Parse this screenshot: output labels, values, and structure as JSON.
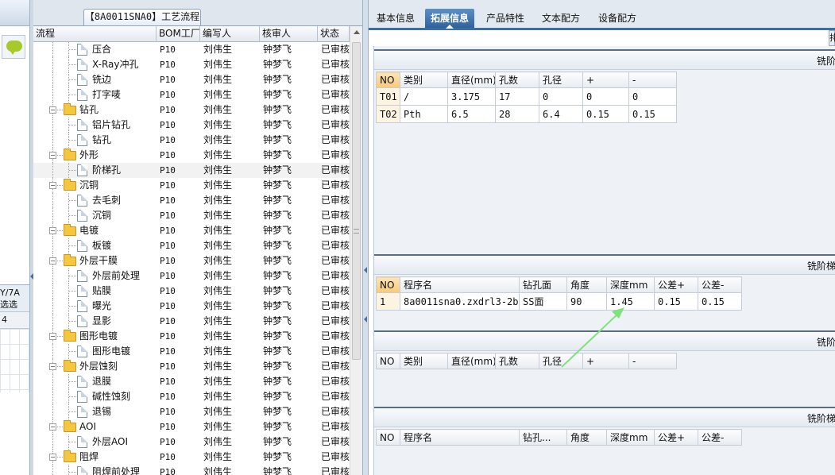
{
  "left_panel": {
    "filter_line1": "Y/7A",
    "filter_line2": "选选",
    "filter_num": "4"
  },
  "tree": {
    "tab_title": "【8A0011SNA0】工艺流程",
    "columns": [
      "流程",
      "BOM工厂",
      "编写人",
      "核审人",
      "状态"
    ],
    "rows": [
      {
        "level": 2,
        "type": "file",
        "name": "压合",
        "bom": "P10",
        "writer": "刘伟生",
        "reviewer": "钟梦飞",
        "status": "已审核"
      },
      {
        "level": 2,
        "type": "file",
        "name": "X-Ray冲孔",
        "bom": "P10",
        "writer": "刘伟生",
        "reviewer": "钟梦飞",
        "status": "已审核"
      },
      {
        "level": 2,
        "type": "file",
        "name": "铣边",
        "bom": "P10",
        "writer": "刘伟生",
        "reviewer": "钟梦飞",
        "status": "已审核"
      },
      {
        "level": 2,
        "type": "file",
        "name": "打字唛",
        "bom": "P10",
        "writer": "刘伟生",
        "reviewer": "钟梦飞",
        "status": "已审核"
      },
      {
        "level": 1,
        "type": "folder",
        "name": "钻孔",
        "bom": "P10",
        "writer": "刘伟生",
        "reviewer": "钟梦飞",
        "status": "已审核"
      },
      {
        "level": 2,
        "type": "file",
        "name": "铝片钻孔",
        "bom": "P10",
        "writer": "刘伟生",
        "reviewer": "钟梦飞",
        "status": "已审核"
      },
      {
        "level": 2,
        "type": "file",
        "name": "钻孔",
        "bom": "P10",
        "writer": "刘伟生",
        "reviewer": "钟梦飞",
        "status": "已审核"
      },
      {
        "level": 1,
        "type": "folder",
        "name": "外形",
        "bom": "P10",
        "writer": "刘伟生",
        "reviewer": "钟梦飞",
        "status": "已审核"
      },
      {
        "level": 2,
        "type": "file",
        "name": "阶梯孔",
        "bom": "P10",
        "writer": "刘伟生",
        "reviewer": "钟梦飞",
        "status": "已审核",
        "selected": true
      },
      {
        "level": 1,
        "type": "folder",
        "name": "沉铜",
        "bom": "P10",
        "writer": "刘伟生",
        "reviewer": "钟梦飞",
        "status": "已审核"
      },
      {
        "level": 2,
        "type": "file",
        "name": "去毛刺",
        "bom": "P10",
        "writer": "刘伟生",
        "reviewer": "钟梦飞",
        "status": "已审核"
      },
      {
        "level": 2,
        "type": "file",
        "name": "沉铜",
        "bom": "P10",
        "writer": "刘伟生",
        "reviewer": "钟梦飞",
        "status": "已审核"
      },
      {
        "level": 1,
        "type": "folder",
        "name": "电镀",
        "bom": "P10",
        "writer": "刘伟生",
        "reviewer": "钟梦飞",
        "status": "已审核"
      },
      {
        "level": 2,
        "type": "file",
        "name": "板镀",
        "bom": "P10",
        "writer": "刘伟生",
        "reviewer": "钟梦飞",
        "status": "已审核"
      },
      {
        "level": 1,
        "type": "folder",
        "name": "外层干膜",
        "bom": "P10",
        "writer": "刘伟生",
        "reviewer": "钟梦飞",
        "status": "已审核"
      },
      {
        "level": 2,
        "type": "file",
        "name": "外层前处理",
        "bom": "P10",
        "writer": "刘伟生",
        "reviewer": "钟梦飞",
        "status": "已审核"
      },
      {
        "level": 2,
        "type": "file",
        "name": "贴膜",
        "bom": "P10",
        "writer": "刘伟生",
        "reviewer": "钟梦飞",
        "status": "已审核"
      },
      {
        "level": 2,
        "type": "file",
        "name": "曝光",
        "bom": "P10",
        "writer": "刘伟生",
        "reviewer": "钟梦飞",
        "status": "已审核"
      },
      {
        "level": 2,
        "type": "file",
        "name": "显影",
        "bom": "P10",
        "writer": "刘伟生",
        "reviewer": "钟梦飞",
        "status": "已审核"
      },
      {
        "level": 1,
        "type": "folder",
        "name": "图形电镀",
        "bom": "P10",
        "writer": "刘伟生",
        "reviewer": "钟梦飞",
        "status": "已审核"
      },
      {
        "level": 2,
        "type": "file",
        "name": "图形电镀",
        "bom": "P10",
        "writer": "刘伟生",
        "reviewer": "钟梦飞",
        "status": "已审核"
      },
      {
        "level": 1,
        "type": "folder",
        "name": "外层蚀刻",
        "bom": "P10",
        "writer": "刘伟生",
        "reviewer": "钟梦飞",
        "status": "已审核"
      },
      {
        "level": 2,
        "type": "file",
        "name": "退膜",
        "bom": "P10",
        "writer": "刘伟生",
        "reviewer": "钟梦飞",
        "status": "已审核"
      },
      {
        "level": 2,
        "type": "file",
        "name": "碱性蚀刻",
        "bom": "P10",
        "writer": "刘伟生",
        "reviewer": "钟梦飞",
        "status": "已审核"
      },
      {
        "level": 2,
        "type": "file",
        "name": "退锡",
        "bom": "P10",
        "writer": "刘伟生",
        "reviewer": "钟梦飞",
        "status": "已审核"
      },
      {
        "level": 1,
        "type": "folder",
        "name": "AOI",
        "bom": "P10",
        "writer": "刘伟生",
        "reviewer": "钟梦飞",
        "status": "已审核"
      },
      {
        "level": 2,
        "type": "file",
        "name": "外层AOI",
        "bom": "P10",
        "writer": "刘伟生",
        "reviewer": "钟梦飞",
        "status": "已审核"
      },
      {
        "level": 1,
        "type": "folder",
        "name": "阻焊",
        "bom": "P10",
        "writer": "刘伟生",
        "reviewer": "钟梦飞",
        "status": "已审核"
      },
      {
        "level": 2,
        "type": "file",
        "name": "阻焊前处理",
        "bom": "P10",
        "writer": "刘伟生",
        "reviewer": "钟梦飞",
        "status": "已审核"
      }
    ]
  },
  "right": {
    "tabs": [
      "基本信息",
      "拓展信息",
      "产品特性",
      "文本配方",
      "设备配方"
    ],
    "active_tab": 1,
    "top_button": "排",
    "sections": [
      {
        "title": "铣阶",
        "columns": [
          "NO",
          "类别",
          "直径(mm)",
          "孔数",
          "孔径",
          "+",
          "-"
        ],
        "rows": [
          [
            "T01",
            "/",
            "3.175",
            "17",
            "0",
            "0",
            "0"
          ],
          [
            "T02",
            "Pth",
            "6.5",
            "28",
            "6.4",
            "0.15",
            "0.15"
          ]
        ]
      },
      {
        "title": "铣阶梯",
        "columns": [
          "NO",
          "程序名",
          "钻孔面",
          "角度",
          "深度mm",
          "公差+",
          "公差-"
        ],
        "rows": [
          [
            "1",
            "8a0011sna0.zxdrl3-2b",
            "SS面",
            "90",
            "1.45",
            "0.15",
            "0.15"
          ]
        ]
      },
      {
        "title": "铣阶",
        "columns": [
          "NO",
          "类别",
          "直径(mm)",
          "孔数",
          "孔径",
          "+",
          "-"
        ],
        "rows": []
      },
      {
        "title": "铣阶梯",
        "columns": [
          "NO",
          "程序名",
          "钻孔...",
          "角度",
          "深度mm",
          "公差+",
          "公差-"
        ],
        "rows": []
      }
    ]
  },
  "colors": {
    "accent": "#3d6da3",
    "annotation_arrow": "#7ee27e",
    "folder": "#f4c73f"
  }
}
